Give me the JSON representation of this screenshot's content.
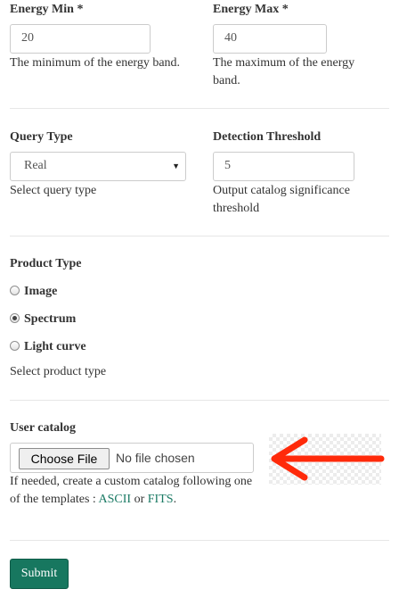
{
  "energy_min": {
    "label": "Energy Min *",
    "value": "20",
    "help": "The minimum of the energy band."
  },
  "energy_max": {
    "label": "Energy Max *",
    "value": "40",
    "help": "The maximum of the energy band."
  },
  "query_type": {
    "label": "Query Type",
    "selected": "Real",
    "help": "Select query type"
  },
  "detection_threshold": {
    "label": "Detection Threshold",
    "value": "5",
    "help": "Output catalog significance threshold"
  },
  "product_type": {
    "label": "Product Type",
    "options": [
      {
        "label": "Image",
        "checked": false
      },
      {
        "label": "Spectrum",
        "checked": true
      },
      {
        "label": "Light curve",
        "checked": false
      }
    ],
    "help": "Select product type"
  },
  "user_catalog": {
    "label": "User catalog",
    "button_label": "Choose File",
    "status": "No file chosen",
    "help_prefix": "If needed, create a custom catalog following one of the templates : ",
    "link_ascii": "ASCII",
    "help_or": " or ",
    "link_fits": "FITS",
    "help_suffix": "."
  },
  "annotation": {
    "arrow_color": "#ff2a0a",
    "arrow_icon": "left-arrow-icon"
  },
  "submit": {
    "label": "Submit",
    "color": "#17775f"
  }
}
